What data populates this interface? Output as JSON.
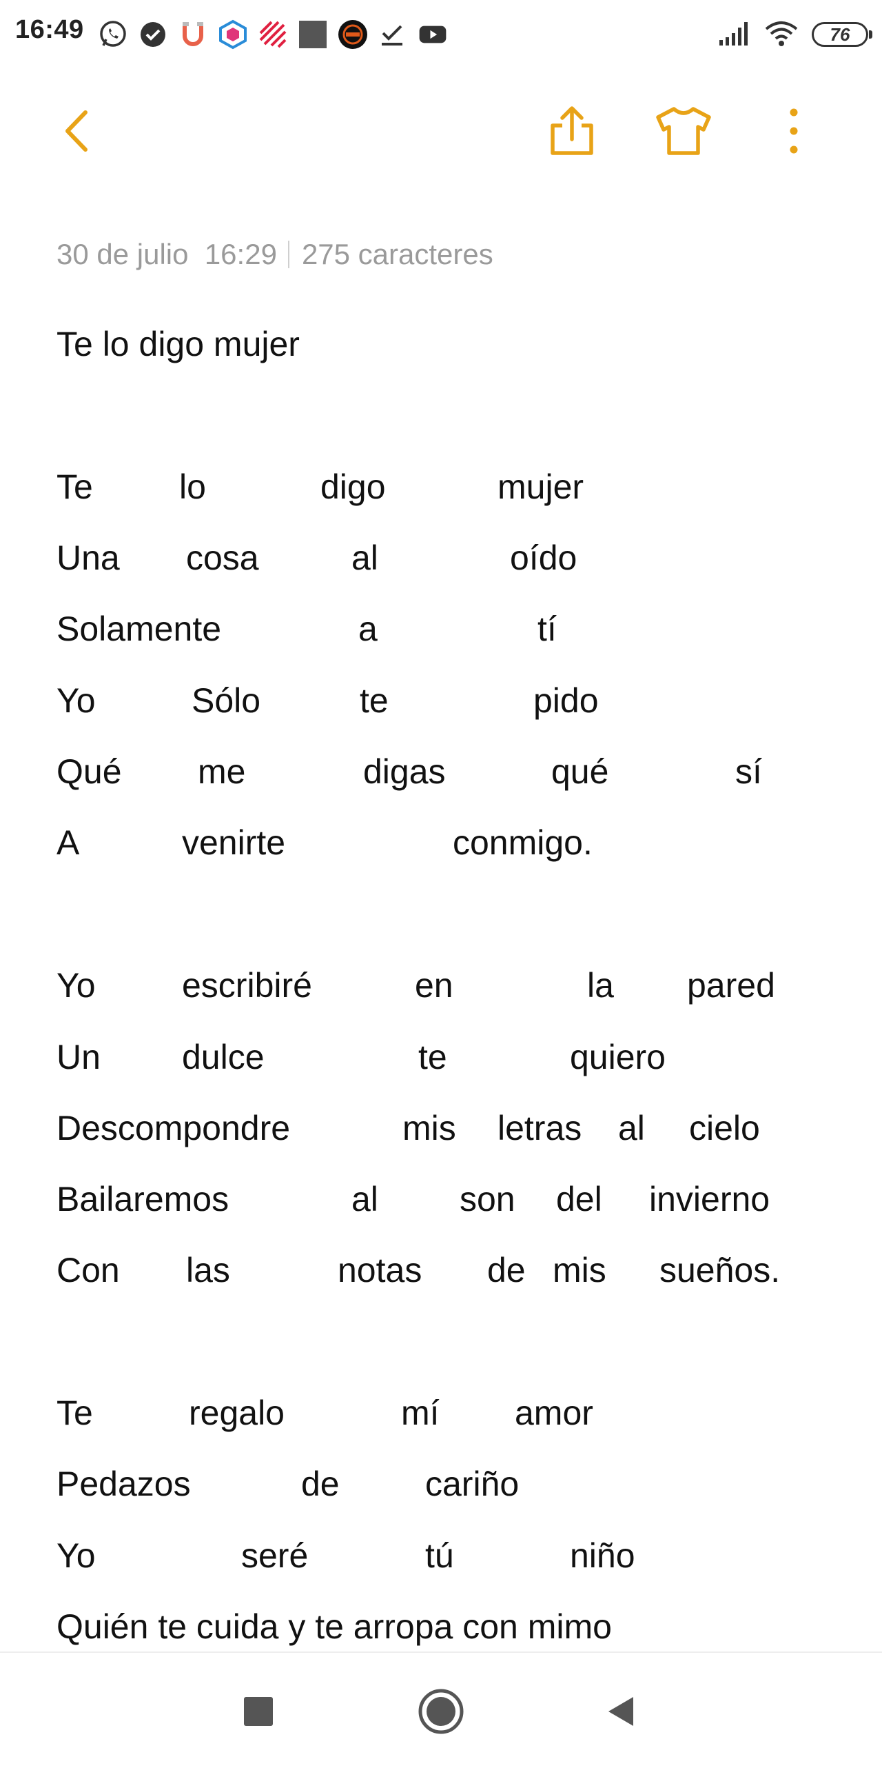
{
  "status_bar": {
    "time": "16:49",
    "battery": "76",
    "notification_icons": [
      "whatsapp-icon",
      "check-circle-icon",
      "magnet-icon",
      "shield-app-icon",
      "stripes-app-icon",
      "square-app-icon",
      "round-app-icon",
      "checkmark-icon",
      "youtube-icon"
    ],
    "system_icons": [
      "signal-icon",
      "wifi-icon",
      "battery-icon"
    ]
  },
  "toolbar": {
    "icons": [
      "back-icon",
      "share-icon",
      "theme-shirt-icon",
      "more-vertical-icon"
    ],
    "accent_color": "#E8A317"
  },
  "note": {
    "date": "30 de julio",
    "time": "16:29",
    "char_count": "275 caracteres",
    "title": "Te lo digo mujer",
    "lines": [
      [
        "Te",
        "lo",
        "digo",
        "mujer"
      ],
      [
        "Una",
        "cosa",
        "al",
        "oído"
      ],
      [
        "Solamente",
        "a",
        "tí"
      ],
      [
        "Yo",
        "Sólo",
        "te",
        "pido"
      ],
      [
        "Qué",
        "me",
        "digas",
        "qué",
        "sí"
      ],
      [
        "A",
        "venirte",
        "conmigo."
      ],
      [
        "Yo",
        "escribiré",
        "en",
        "la",
        "pared"
      ],
      [
        "Un",
        "dulce",
        "te",
        "quiero"
      ],
      [
        "Descompondre",
        "mis",
        "letras",
        "al",
        "cielo"
      ],
      [
        "Bailaremos",
        "al",
        "son",
        "del",
        "invierno"
      ],
      [
        "Con",
        "las",
        "notas",
        "de",
        "mis",
        "sueños."
      ],
      [
        "Te",
        "regalo",
        "mí",
        "amor"
      ],
      [
        "Pedazos",
        "de",
        "cariño"
      ],
      [
        "Yo",
        "seré",
        "tú",
        "niño"
      ],
      [
        "Quién te cuida y te arropa con mimo"
      ]
    ]
  },
  "nav_bar": {
    "icons": [
      "recents-square-icon",
      "home-circle-icon",
      "back-triangle-icon"
    ]
  }
}
